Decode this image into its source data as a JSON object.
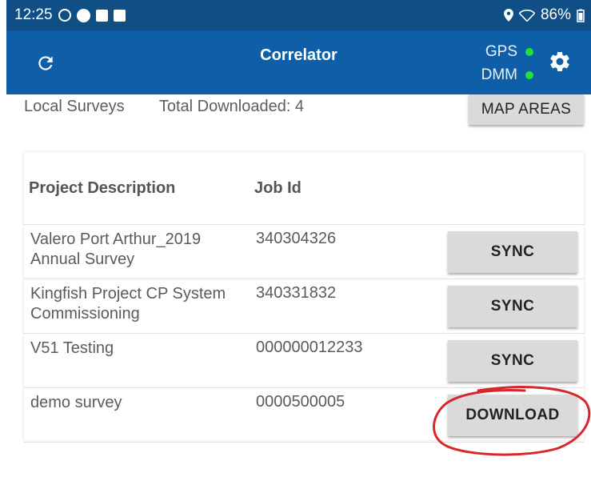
{
  "status_bar": {
    "time": "12:25",
    "battery": "86%",
    "icons": [
      "alarm-icon",
      "android-icon",
      "checkbox-icon",
      "image-icon",
      "location-icon",
      "wifi-icon",
      "battery-icon"
    ]
  },
  "app_bar": {
    "title": "Correlator",
    "gps_label": "GPS",
    "dmm_label": "DMM",
    "indicator_color": "#1fe234",
    "background": "#0f5fa8"
  },
  "summary": {
    "local_surveys": "Local Surveys",
    "total_downloaded": "Total Downloaded: 4",
    "map_areas_label": "MAP AREAS"
  },
  "table": {
    "headers": {
      "description": "Project Description",
      "job_id": "Job Id"
    },
    "rows": [
      {
        "description": "Valero Port Arthur_2019 Annual Survey",
        "job_id": "340304326",
        "action": "SYNC"
      },
      {
        "description": "Kingfish Project CP System Commissioning",
        "job_id": "340331832",
        "action": "SYNC"
      },
      {
        "description": "V51 Testing",
        "job_id": "000000012233",
        "action": "SYNC"
      },
      {
        "description": "demo survey",
        "job_id": "0000500005",
        "action": "DOWNLOAD"
      }
    ]
  },
  "annotation_color": "#d8262b"
}
